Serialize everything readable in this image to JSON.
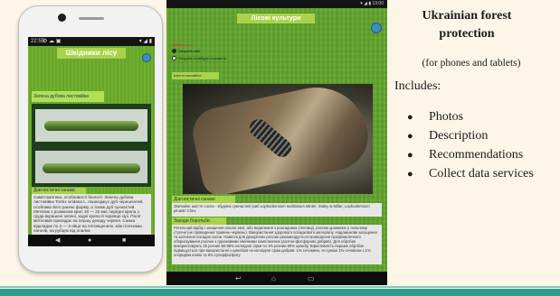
{
  "phone": {
    "status_time": "22:55",
    "status_icons": "⚙ ☁ ▣",
    "status_right": "▾ ◢ ▮",
    "title": "Шкідники лісу",
    "label": "Зелена дубова листовійка",
    "diagnostic_title": "Діагностичні ознаки",
    "description": "Симптоматика, особливості біології. Зелена дубова листовійка Tortrix viridana L. пошкоджує дуб черешчатий, особливо його ранню форму, а також дуб пухнастий. Метелик з розмахом крил 18 — 22 мм; передні крила з груди вкрашені зелені, задні крила й черевце сірі. Політ метеликів припадає на першу декаду червня. Самка відкладає по 2 — 3 яйця на потовщеннях, між гілочками пагонів, на рубцях від опалих"
  },
  "tablet": {
    "status_right": "▾ ◢ ▮ 13:00",
    "title": "Лісові культури",
    "section_title": "Виберіть тип",
    "radio_options": [
      "Хвороба хвої",
      "Хвороба стовбура та кореня"
    ],
    "name_label": "Шютте звичайне",
    "diagnostic_title": "Діагностичні ознаки",
    "diagnostic_text": "Звичайне шютте сосни - збудник сумчастий гриб Lophodermium seditiosum Minter, Staley & Millar; Lophodermium pinastri Chev.",
    "measures_title": "Заходи боротьби.",
    "measures_text": "Ретельний відбір і знищення опалої хвої, або видалення з розсадника (теплиці), рослин уражених у сильному ступені (не проведення травень-червень). Використання здорового посадкового матеріалу. Надлишкове загущення та затінення посадок сосни. Навесні для двохрічних рослин рекомендується проведення профілактичного обприскування рослин з однаковими хімічними комплексних (азотно-фосфорних добрив). Для обробки використовують 25 розчин 60-98% колоїдної сірки чи 1% розчин 80% цинебу. Ефективність перших обробок підвищується при використанні з цинебом чи колоїдної сірки добрив: 1% сечовини, чи суміші 1% сечовини з 1% хлоридом калію та 6% суперфосфату."
  },
  "info": {
    "title": "Ukrainian forest protection",
    "subtitle": "(for phones and tablets)",
    "includes_label": "Includes:",
    "items": [
      "Photos",
      "Description",
      "Recommendations",
      "Collect data services"
    ],
    "bullet": "●"
  },
  "colors": {
    "app_green": "#6aab2a",
    "title_bar": "#a9d34a",
    "accent_teal": "#2a9d8f",
    "page_bg": "#fdf6e8"
  },
  "icons": {
    "nav_back": "◀",
    "nav_home": "●",
    "nav_recent": "■",
    "tablet_back": "↩",
    "tablet_home": "⌂",
    "tablet_recent": "▭"
  }
}
